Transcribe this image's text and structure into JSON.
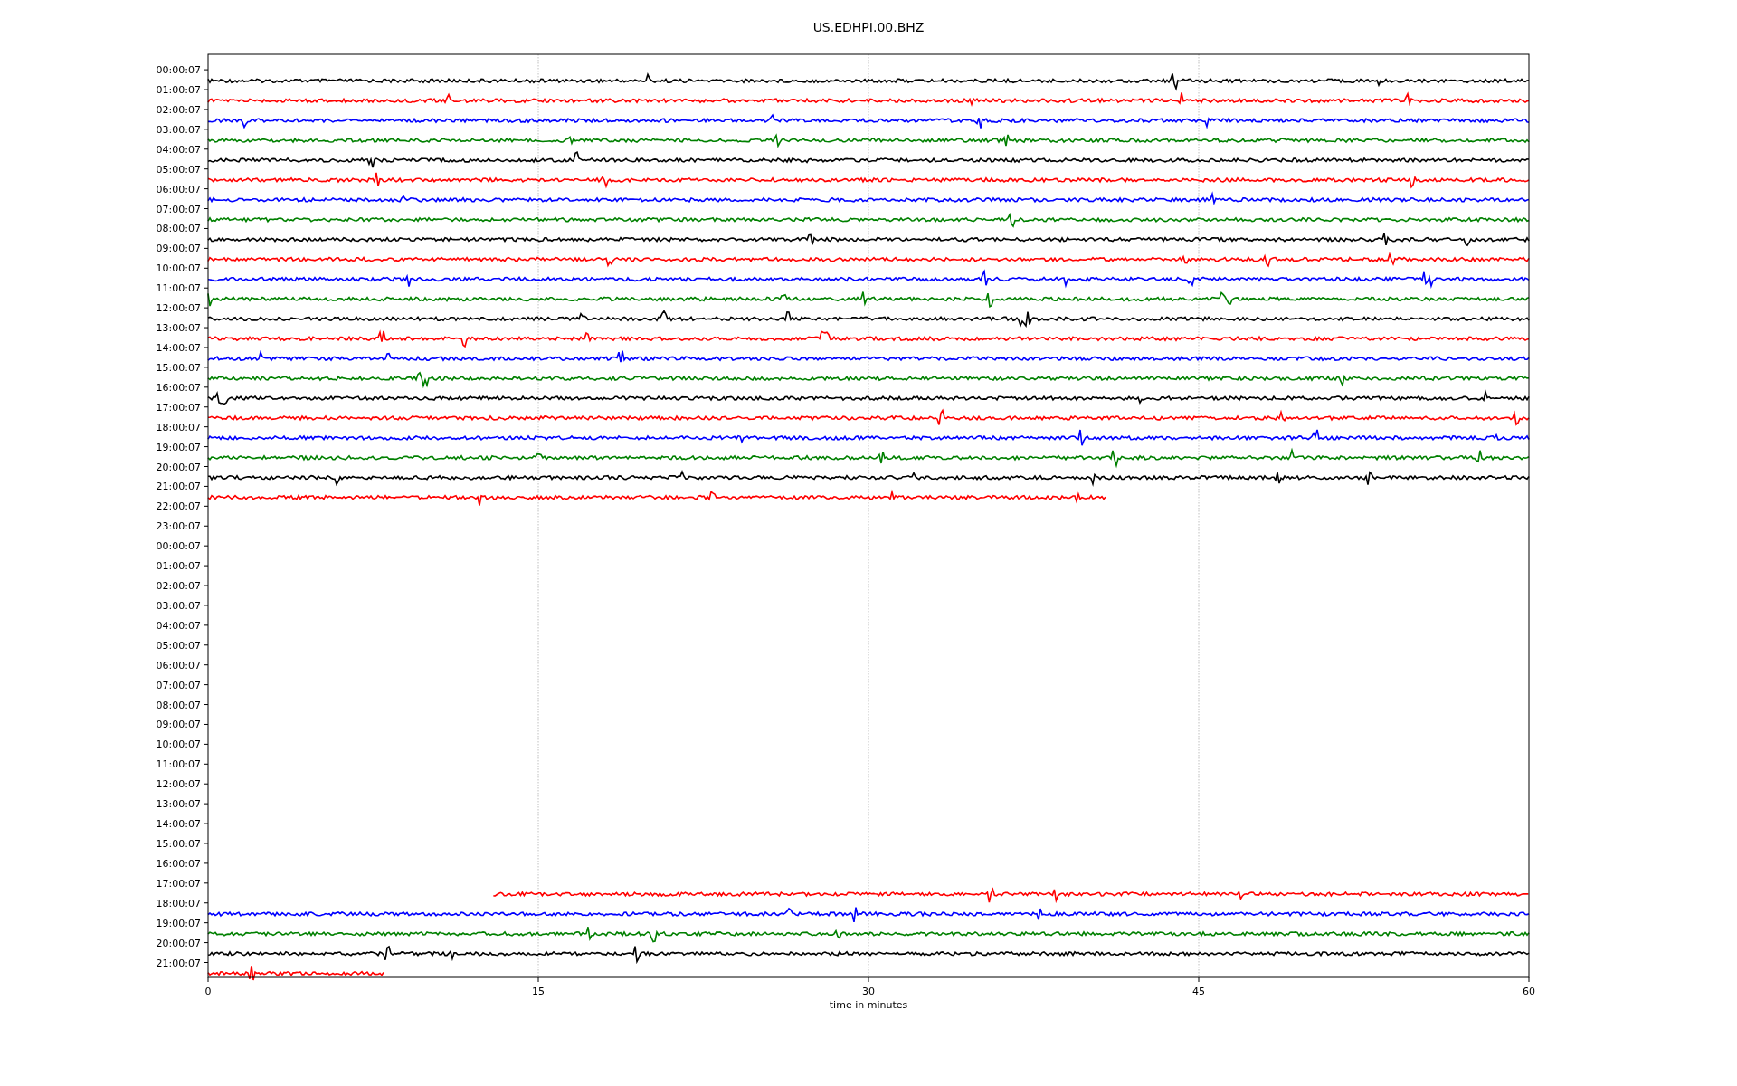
{
  "title": "US.EDHPI.00.BHZ",
  "chart": {
    "xlabel": "time in minutes",
    "xticks": [
      "0",
      "15",
      "30",
      "45",
      "60"
    ],
    "rows": [
      {
        "label": "00:00:07",
        "trace": {
          "color": "#000000",
          "level": 1
        }
      },
      {
        "label": "01:00:07",
        "trace": {
          "color": "#ff0000",
          "level": 1
        }
      },
      {
        "label": "02:00:07",
        "trace": {
          "color": "#0000ff",
          "level": 1
        }
      },
      {
        "label": "03:00:07",
        "trace": {
          "color": "#008000",
          "level": 1
        }
      },
      {
        "label": "04:00:07",
        "trace": {
          "color": "#000000",
          "level": 1
        }
      },
      {
        "label": "05:00:07",
        "trace": {
          "color": "#ff0000",
          "level": 1
        }
      },
      {
        "label": "06:00:07",
        "trace": {
          "color": "#0000ff",
          "level": 1
        }
      },
      {
        "label": "07:00:07",
        "trace": {
          "color": "#008000",
          "level": 1
        }
      },
      {
        "label": "08:00:07",
        "trace": {
          "color": "#000000",
          "level": 1
        }
      },
      {
        "label": "09:00:07",
        "trace": {
          "color": "#ff0000",
          "level": 1
        }
      },
      {
        "label": "10:00:07",
        "trace": {
          "color": "#0000ff",
          "level": 1
        }
      },
      {
        "label": "11:00:07",
        "trace": {
          "color": "#008000",
          "level": 1
        }
      },
      {
        "label": "12:00:07",
        "trace": {
          "color": "#000000",
          "level": 1
        }
      },
      {
        "label": "13:00:07",
        "trace": {
          "color": "#ff0000",
          "level": 1
        }
      },
      {
        "label": "14:00:07",
        "trace": {
          "color": "#0000ff",
          "level": 1
        }
      },
      {
        "label": "15:00:07",
        "trace": {
          "color": "#008000",
          "level": 1
        }
      },
      {
        "label": "16:00:07",
        "trace": {
          "color": "#000000",
          "level": 1
        }
      },
      {
        "label": "17:00:07",
        "trace": {
          "color": "#ff0000",
          "level": 1
        }
      },
      {
        "label": "18:00:07",
        "trace": {
          "color": "#0000ff",
          "level": 1
        }
      },
      {
        "label": "19:00:07",
        "trace": {
          "color": "#008000",
          "level": 1
        }
      },
      {
        "label": "20:00:07",
        "trace": {
          "color": "#000000",
          "level": 1
        }
      },
      {
        "label": "21:00:07",
        "trace": {
          "color": "#ff0000",
          "level": 0.68
        }
      },
      {
        "label": "22:00:07"
      },
      {
        "label": "23:00:07"
      },
      {
        "label": "00:00:07"
      },
      {
        "label": "01:00:07"
      },
      {
        "label": "02:00:07"
      },
      {
        "label": "03:00:07"
      },
      {
        "label": "04:00:07"
      },
      {
        "label": "05:00:07"
      },
      {
        "label": "06:00:07"
      },
      {
        "label": "07:00:07"
      },
      {
        "label": "08:00:07"
      },
      {
        "label": "09:00:07"
      },
      {
        "label": "10:00:07"
      },
      {
        "label": "11:00:07"
      },
      {
        "label": "12:00:07"
      },
      {
        "label": "13:00:07"
      },
      {
        "label": "14:00:07"
      },
      {
        "label": "15:00:07"
      },
      {
        "label": "16:00:07"
      },
      {
        "label": "17:00:07",
        "trace": {
          "color": "#ff0000",
          "level": 0.784,
          "right_aligned": true
        }
      },
      {
        "label": "18:00:07",
        "trace": {
          "color": "#0000ff",
          "level": 1
        }
      },
      {
        "label": "19:00:07",
        "trace": {
          "color": "#008000",
          "level": 1
        }
      },
      {
        "label": "20:00:07",
        "trace": {
          "color": "#000000",
          "level": 1
        }
      },
      {
        "label": "21:00:07",
        "trace": {
          "color": "#ff0000",
          "level": 0.133
        }
      }
    ]
  }
}
